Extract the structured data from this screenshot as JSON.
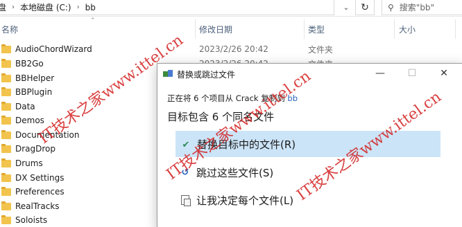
{
  "address": {
    "crumbs": [
      "本地磁盘 (C:)",
      "bb"
    ],
    "partial_left": "盘",
    "search_placeholder": "搜索\"bb\""
  },
  "columns": [
    "名称",
    "修改日期",
    "类型",
    "大小"
  ],
  "files": [
    {
      "name": "AudioChordWizard",
      "date": "2023/2/26 20:42",
      "type": "文件夹"
    },
    {
      "name": "BB2Go",
      "date": "2023/2/26 20:42",
      "type": "文件夹"
    },
    {
      "name": "BBHelper",
      "date": "",
      "type": ""
    },
    {
      "name": "BBPlugin",
      "date": "",
      "type": ""
    },
    {
      "name": "Data",
      "date": "",
      "type": ""
    },
    {
      "name": "Demos",
      "date": "",
      "type": ""
    },
    {
      "name": "Documentation",
      "date": "",
      "type": ""
    },
    {
      "name": "DragDrop",
      "date": "",
      "type": ""
    },
    {
      "name": "Drums",
      "date": "",
      "type": ""
    },
    {
      "name": "DX Settings",
      "date": "",
      "type": ""
    },
    {
      "name": "Preferences",
      "date": "",
      "type": ""
    },
    {
      "name": "RealTracks",
      "date": "",
      "type": ""
    },
    {
      "name": "Soloists",
      "date": "",
      "type": ""
    }
  ],
  "dialog": {
    "title": "替换或跳过文件",
    "subtitle_prefix": "正在将 6 个项目从 ",
    "subtitle_src": "Crack",
    "subtitle_mid": " 复制到 ",
    "subtitle_dest": "bb",
    "heading": "目标包含 6 个同名文件",
    "options": [
      {
        "label": "替换目标中的文件(R)",
        "icon": "check-icon"
      },
      {
        "label": "跳过这些文件(S)",
        "icon": "skip-icon"
      },
      {
        "label": "让我决定每个文件(L)",
        "icon": "decide-icon"
      }
    ],
    "minimize": "—",
    "maximize": "☐",
    "close": "✕"
  },
  "watermarks": [
    "IT技术之家www.ittel.cn",
    "IT技术之家www.ittel.cn",
    "IT技术之家www.ittel.cn"
  ],
  "colors": {
    "selected": "#cce4f7",
    "watermark": "#d32020",
    "folder": "#f2c44d",
    "link": "#2a63b9"
  }
}
